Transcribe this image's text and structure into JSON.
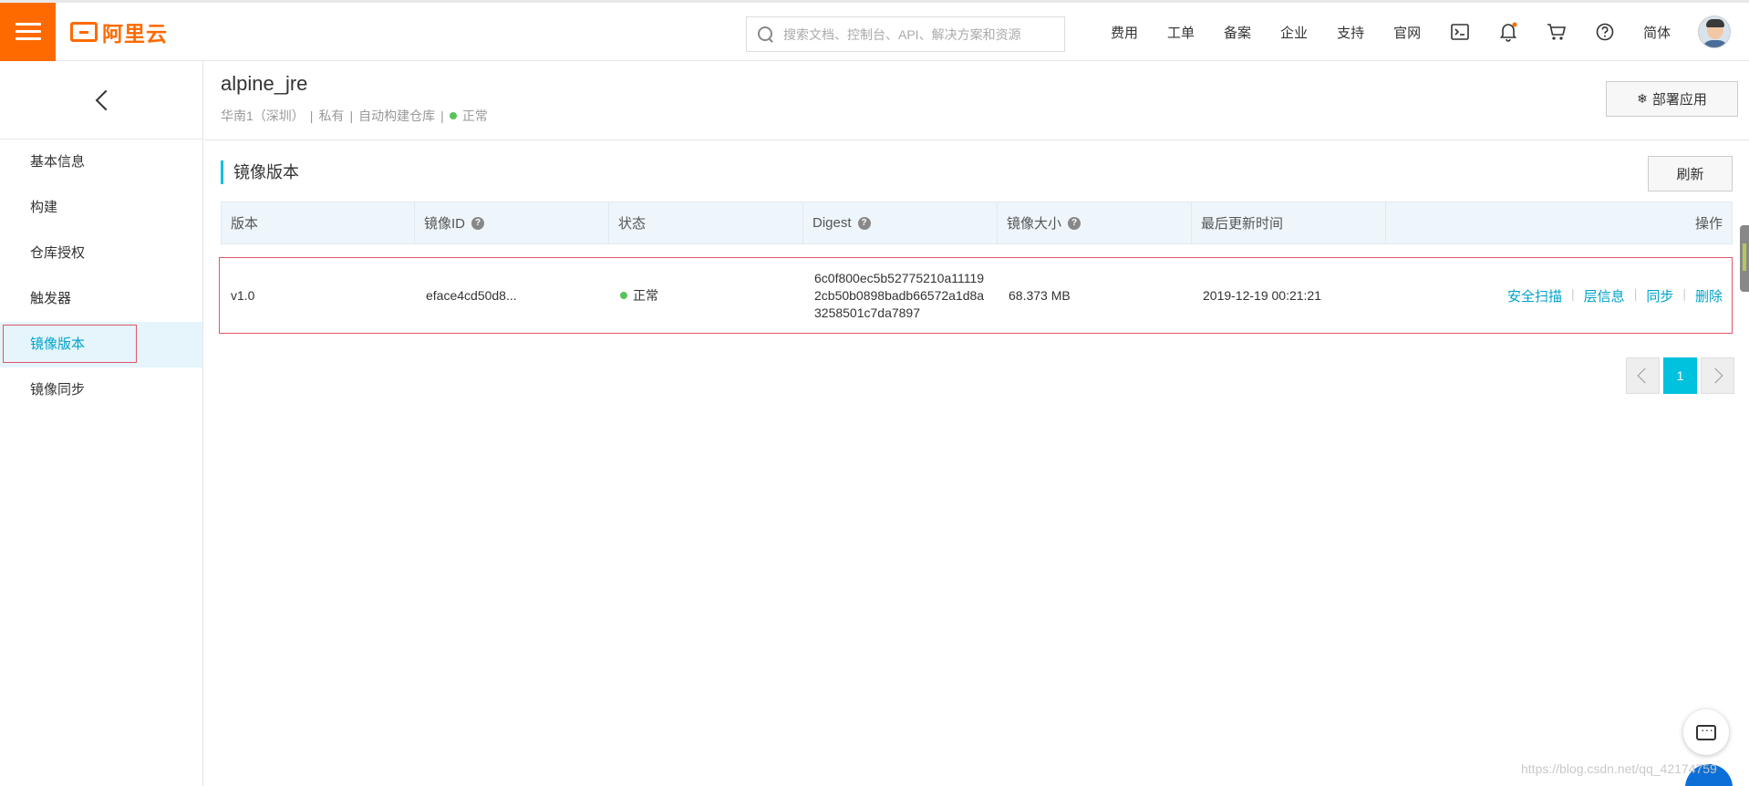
{
  "header": {
    "logo_text": "阿里云",
    "search_placeholder": "搜索文档、控制台、API、解决方案和资源",
    "nav": [
      "费用",
      "工单",
      "备案",
      "企业",
      "支持",
      "官网"
    ],
    "lang": "简体",
    "icons": [
      "terminal-icon",
      "bell-icon",
      "cart-icon",
      "help-icon"
    ],
    "notification_dot_color": "#ff6a00"
  },
  "sidebar": {
    "items": [
      {
        "label": "基本信息"
      },
      {
        "label": "构建"
      },
      {
        "label": "仓库授权"
      },
      {
        "label": "触发器"
      },
      {
        "label": "镜像版本"
      },
      {
        "label": "镜像同步"
      }
    ],
    "active_index": 4
  },
  "repo": {
    "title": "alpine_jre",
    "region": "华南1（深圳）",
    "visibility": "私有",
    "source": "自动构建仓库",
    "status": "正常",
    "deploy_label": "部署应用"
  },
  "section": {
    "title": "镜像版本",
    "refresh_label": "刷新"
  },
  "table": {
    "headers": [
      "版本",
      "镜像ID",
      "状态",
      "Digest",
      "镜像大小",
      "最后更新时间",
      "操作"
    ],
    "rows": [
      {
        "version": "v1.0",
        "image_id": "eface4cd50d8...",
        "status": "正常",
        "digest": "6c0f800ec5b52775210a111192cb50b0898badb66572a1d8a3258501c7da7897",
        "size": "68.373 MB",
        "updated": "2019-12-19 00:21:21",
        "actions": [
          "安全扫描",
          "层信息",
          "同步",
          "删除"
        ]
      }
    ]
  },
  "pagination": {
    "current": "1"
  },
  "watermark": "https://blog.csdn.net/qq_42174759",
  "colors": {
    "brand": "#ff6a00",
    "accent": "#00c1de",
    "link": "#00a2ca",
    "status_ok": "#5ac35a",
    "highlight": "#e0566a"
  }
}
